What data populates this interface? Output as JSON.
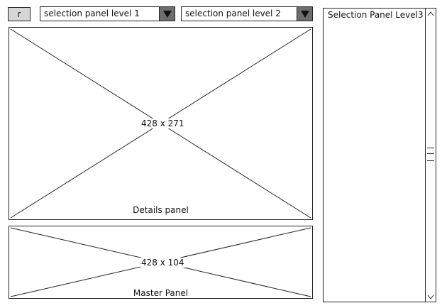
{
  "toolbar": {
    "r_button_label": "r",
    "dropdown1": {
      "selected": "selection panel level 1",
      "arrow_icon": "triangle-down-icon"
    },
    "dropdown2": {
      "selected": "selection panel level 2",
      "arrow_icon": "triangle-down-icon"
    }
  },
  "details_panel": {
    "dimensions": "428 x 271",
    "caption": "Details panel"
  },
  "master_panel": {
    "dimensions": "428 x 104",
    "caption": "Master Panel"
  },
  "list_panel": {
    "title": "Selection Panel Level3",
    "scroll_up_icon": "chevron-up-icon",
    "scroll_down_icon": "chevron-down-icon"
  },
  "colors": {
    "button_fill": "#d6d6d6",
    "dropdown_arrow_fill": "#6e6e6e",
    "stroke": "#222222"
  }
}
